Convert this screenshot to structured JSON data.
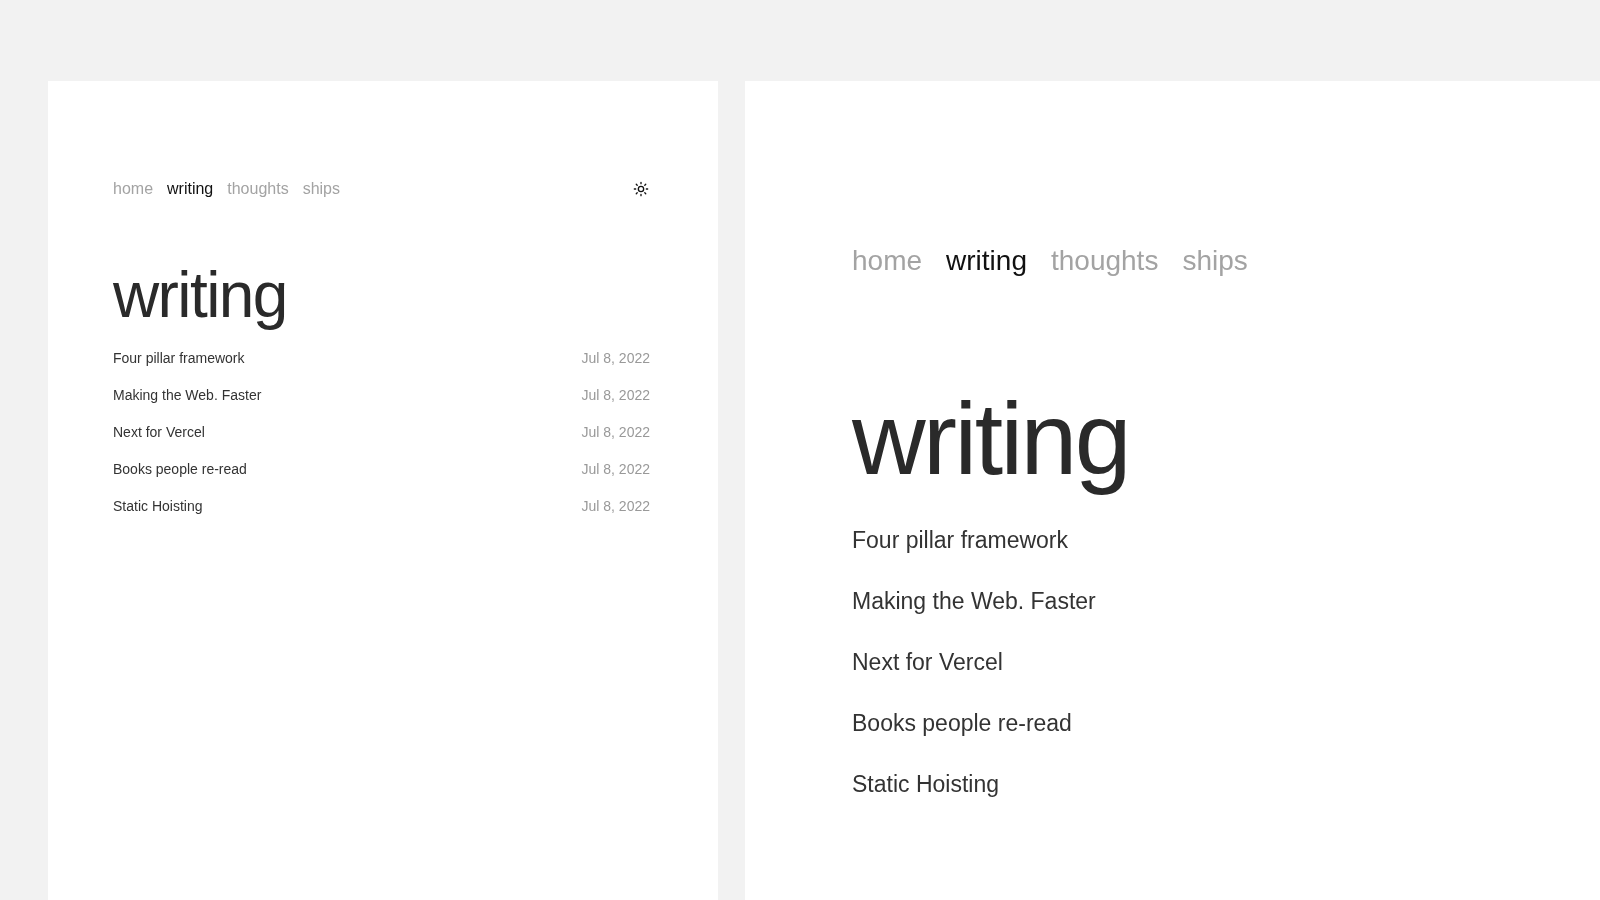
{
  "panels": [
    {
      "kind": "compact",
      "nav": [
        {
          "label": "home",
          "selected": false
        },
        {
          "label": "writing",
          "selected": true
        },
        {
          "label": "thoughts",
          "selected": false
        },
        {
          "label": "ships",
          "selected": false
        }
      ],
      "theme_toggle": true,
      "heading": "writing",
      "posts": [
        {
          "title": "Four pillar framework",
          "date": "Jul 8, 2022"
        },
        {
          "title": "Making the Web. Faster",
          "date": "Jul 8, 2022"
        },
        {
          "title": "Next for Vercel",
          "date": "Jul 8, 2022"
        },
        {
          "title": "Books people re-read",
          "date": "Jul 8, 2022"
        },
        {
          "title": "Static Hoisting",
          "date": "Jul 8, 2022"
        }
      ]
    },
    {
      "kind": "zoomed",
      "nav": [
        {
          "label": "home",
          "selected": false
        },
        {
          "label": "writing",
          "selected": true
        },
        {
          "label": "thoughts",
          "selected": false
        },
        {
          "label": "ships",
          "selected": false
        }
      ],
      "theme_toggle": false,
      "heading": "writing",
      "posts": [
        {
          "title": "Four pillar framework"
        },
        {
          "title": "Making the Web. Faster"
        },
        {
          "title": "Next for Vercel"
        },
        {
          "title": "Books people re-read"
        },
        {
          "title": "Static Hoisting"
        }
      ]
    }
  ]
}
